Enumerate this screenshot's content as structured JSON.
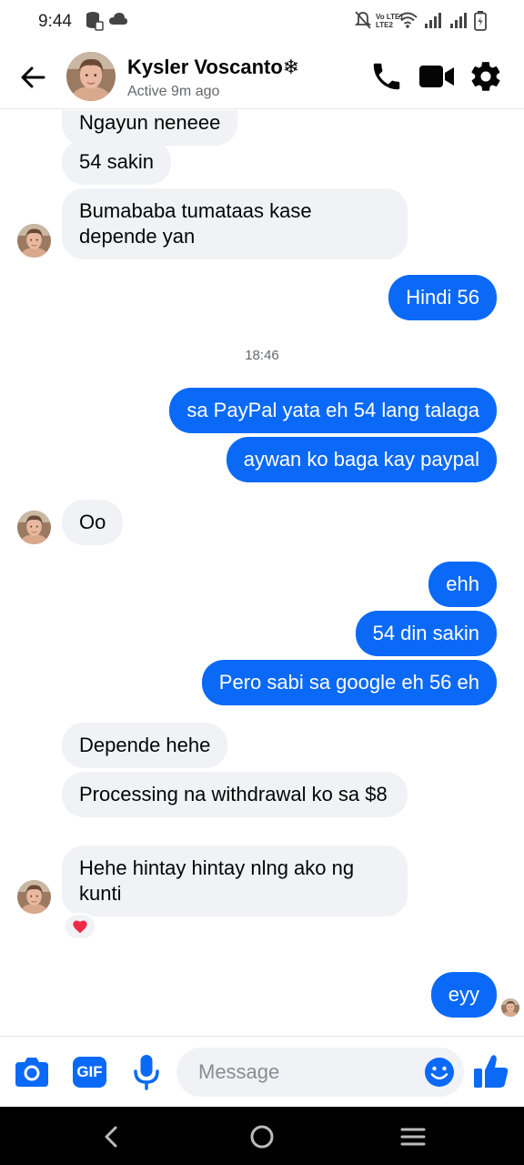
{
  "status_bar": {
    "time": "9:44",
    "volte_line1": "Vo LTE1",
    "volte_line2": "LTE2",
    "icons": [
      "storage-icon",
      "cloud-icon",
      "mute-icon",
      "wifi-icon",
      "signal-icon",
      "signal-icon",
      "battery-icon"
    ]
  },
  "header": {
    "contact_name": "Kysler  Voscanto❄",
    "active_status": "Active 9m ago",
    "icons": [
      "back-arrow-icon",
      "phone-icon",
      "video-camera-icon",
      "gear-icon"
    ]
  },
  "colors": {
    "outgoing_bubble": "#0b69f7",
    "incoming_bubble": "#f0f2f5",
    "accent": "#0b69f7"
  },
  "messages": [
    {
      "dir": "in",
      "text": "Ngayun neneee"
    },
    {
      "dir": "in",
      "text": "54 sakin"
    },
    {
      "dir": "in",
      "text": "Bumababa tumataas kase depende yan"
    },
    {
      "dir": "out",
      "text": "Hindi 56"
    },
    {
      "timestamp": "18:46"
    },
    {
      "dir": "out",
      "text": "sa PayPal yata eh 54 lang talaga"
    },
    {
      "dir": "out",
      "text": "aywan ko baga kay paypal"
    },
    {
      "dir": "in",
      "text": "Oo"
    },
    {
      "dir": "out",
      "text": "ehh"
    },
    {
      "dir": "out",
      "text": "54 din sakin"
    },
    {
      "dir": "out",
      "text": "Pero sabi sa google eh 56 eh"
    },
    {
      "dir": "in",
      "text": "Depende hehe"
    },
    {
      "dir": "in",
      "text": "Processing na withdrawal ko sa $8"
    },
    {
      "dir": "in",
      "text": "Hehe hintay hintay nlng ako ng kunti",
      "reaction": "heart"
    },
    {
      "dir": "out",
      "text": "eyy"
    }
  ],
  "composer": {
    "placeholder": "Message",
    "value": "",
    "gif_label": "GIF",
    "icons": [
      "camera-icon",
      "gif-icon",
      "microphone-icon",
      "emoji-icon",
      "thumbs-up-icon"
    ]
  },
  "nav_bar": {
    "icons": [
      "nav-back-icon",
      "nav-home-icon",
      "nav-recents-icon"
    ]
  }
}
